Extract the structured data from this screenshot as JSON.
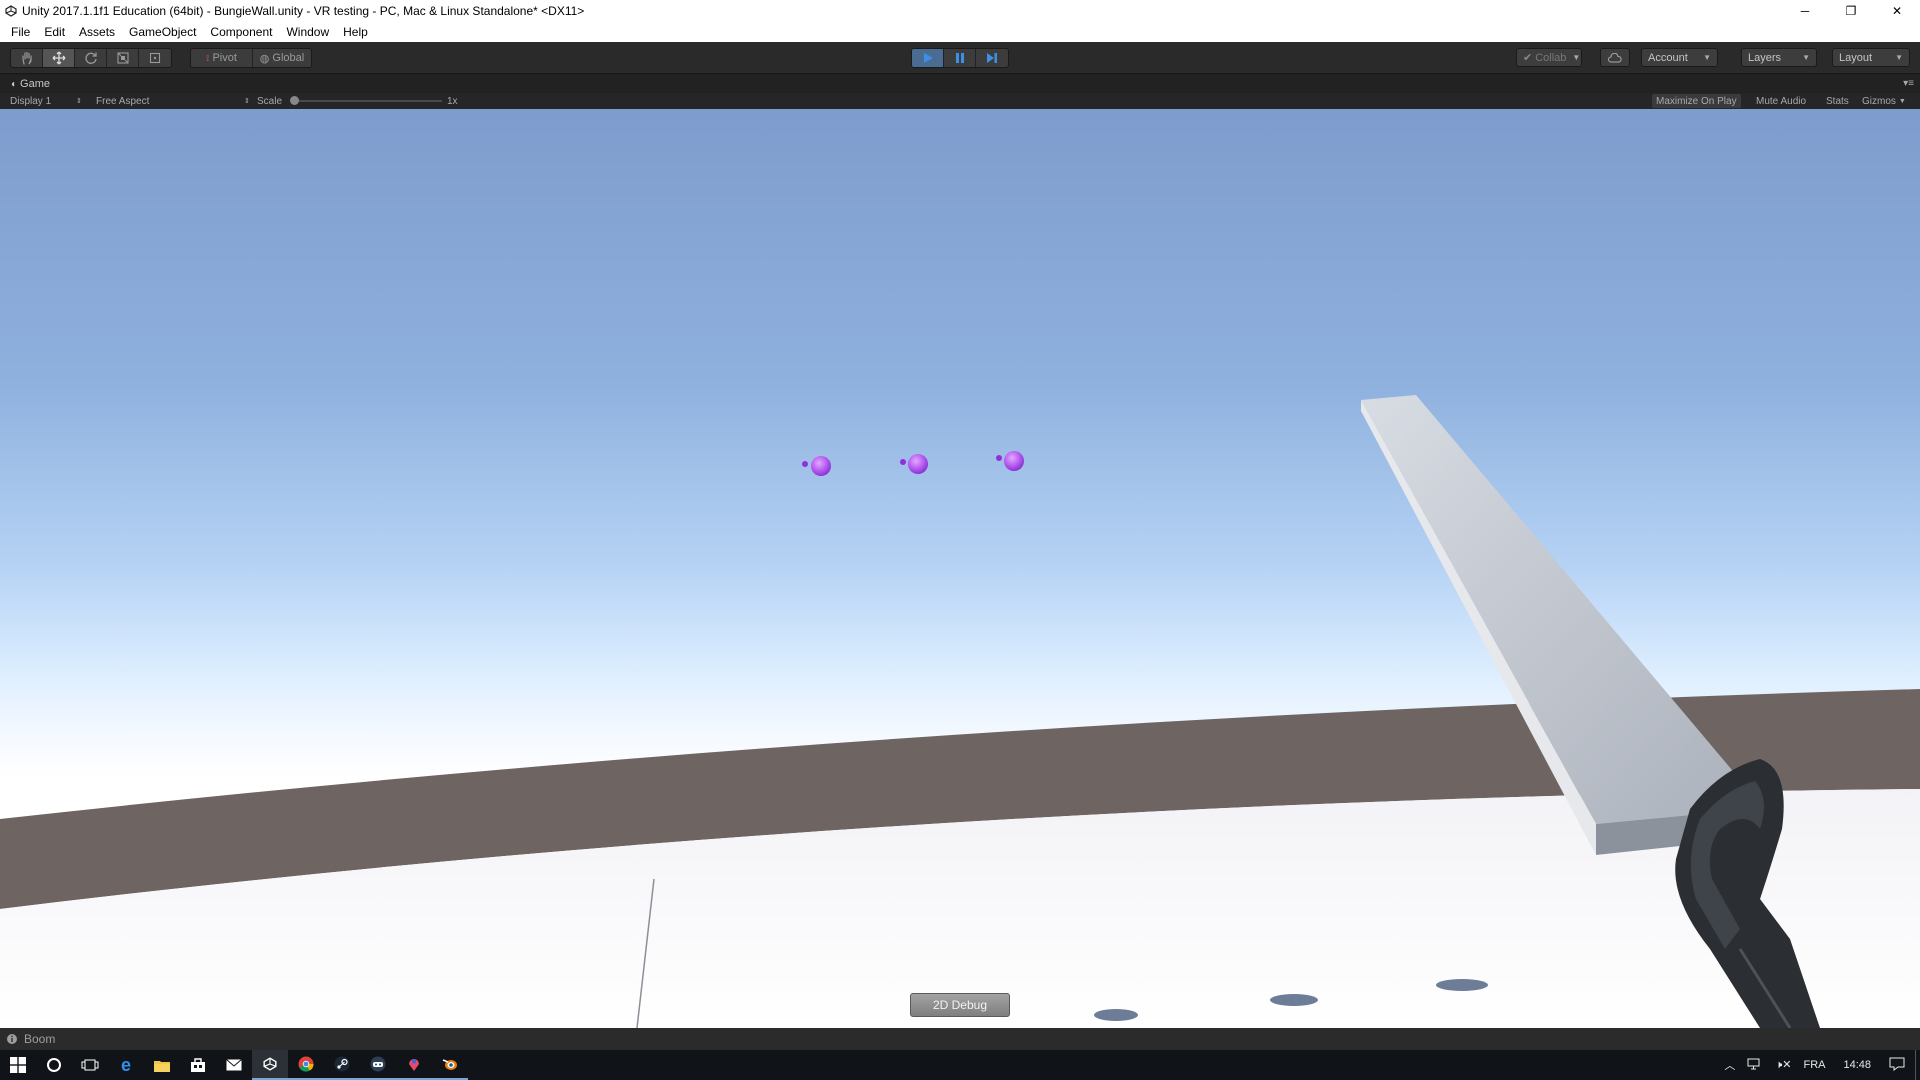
{
  "window": {
    "title": "Unity 2017.1.1f1 Education (64bit) - BungieWall.unity - VR testing - PC, Mac & Linux Standalone* <DX11>",
    "controls": {
      "minimize": "─",
      "restore": "❐",
      "close": "✕"
    }
  },
  "menu": [
    "File",
    "Edit",
    "Assets",
    "GameObject",
    "Component",
    "Window",
    "Help"
  ],
  "toolbar": {
    "pivot_label": "Pivot",
    "global_label": "Global",
    "collab_label": "Collab",
    "account_label": "Account",
    "layers_label": "Layers",
    "layout_label": "Layout",
    "play_state": "playing"
  },
  "game_view": {
    "tab_label": "Game",
    "display_label": "Display 1",
    "aspect_label": "Free Aspect",
    "scale_label": "Scale",
    "scale_value": "1x",
    "maximize_on_play": "Maximize On Play",
    "mute_audio": "Mute Audio",
    "stats": "Stats",
    "gizmos": "Gizmos",
    "debug_button": "2D Debug"
  },
  "status": {
    "message": "Boom"
  },
  "taskbar": {
    "apps": [
      "windows-start",
      "cortana",
      "task-view",
      "edge",
      "file-explorer",
      "store",
      "mail",
      "unity",
      "chrome",
      "steam",
      "steamvr",
      "maps",
      "blender"
    ],
    "tray": {
      "language": "FRA",
      "time": "14:48"
    }
  },
  "colors": {
    "sky_top": "#7e9ccd",
    "horizon": "#ffffff",
    "ground_band": "#6e6462",
    "sphere": "#b55cf0",
    "play_accent": "#4b6c92"
  }
}
